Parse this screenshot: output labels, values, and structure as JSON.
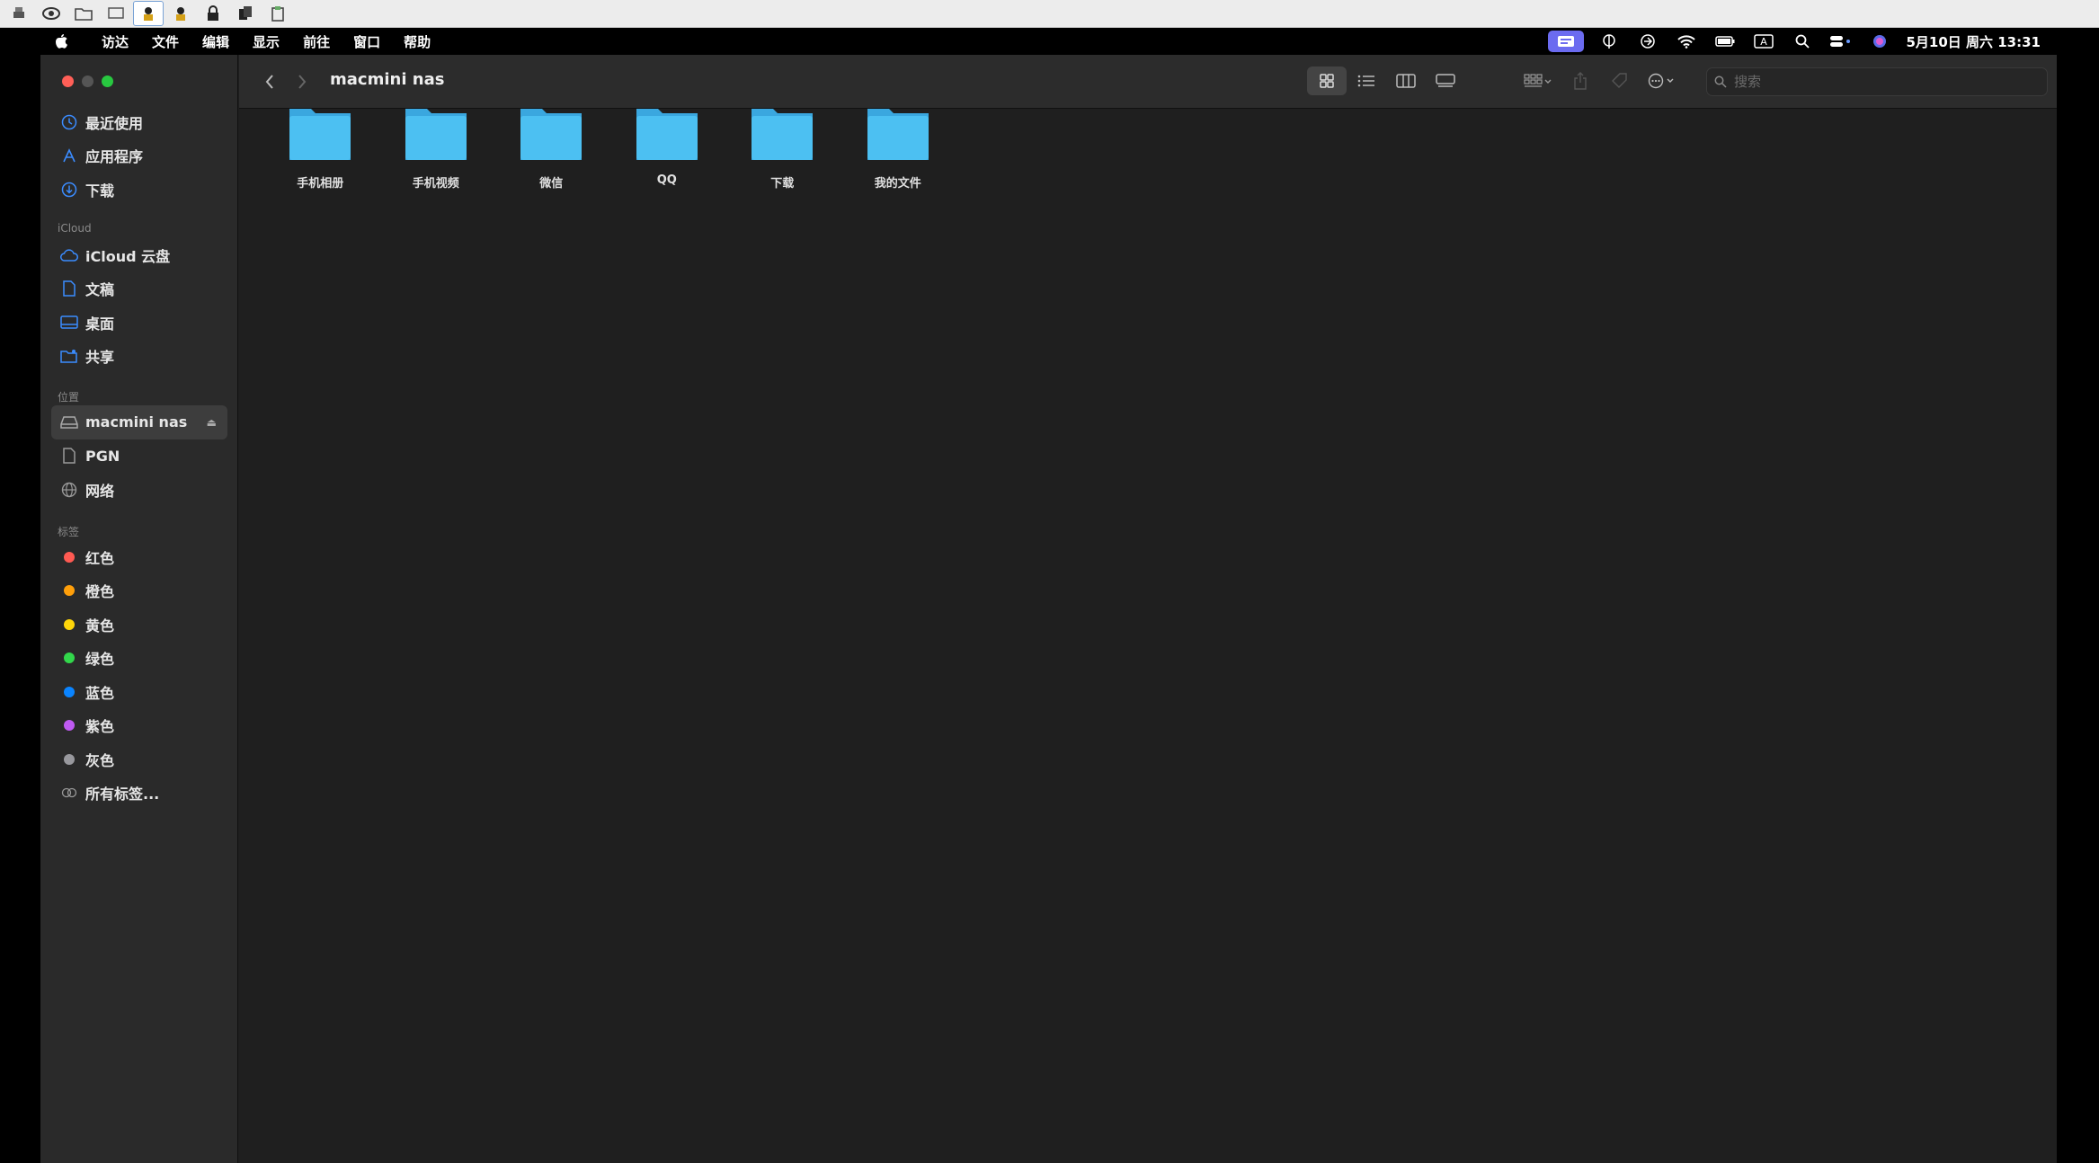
{
  "menubar": {
    "app_name": "访达",
    "items": [
      "文件",
      "编辑",
      "显示",
      "前往",
      "窗口",
      "帮助"
    ],
    "clock": "5月10日 周六 13:31"
  },
  "window": {
    "path_title": "macmini nas",
    "search_placeholder": "搜索"
  },
  "sidebar": {
    "favorites": [
      {
        "label": "最近使用",
        "icon": "clock-icon"
      },
      {
        "label": "应用程序",
        "icon": "apps-icon"
      },
      {
        "label": "下载",
        "icon": "download-icon"
      }
    ],
    "icloud_header": "iCloud",
    "icloud": [
      {
        "label": "iCloud 云盘",
        "icon": "cloud-icon"
      },
      {
        "label": "文稿",
        "icon": "document-icon"
      },
      {
        "label": "桌面",
        "icon": "desktop-icon"
      },
      {
        "label": "共享",
        "icon": "shared-folder-icon"
      }
    ],
    "locations_header": "位置",
    "locations": [
      {
        "label": "macmini nas",
        "icon": "drive-icon",
        "selected": true
      },
      {
        "label": "PGN",
        "icon": "document-icon"
      },
      {
        "label": "网络",
        "icon": "network-icon"
      }
    ],
    "tags_header": "标签",
    "tags": [
      {
        "label": "红色",
        "color": "#ff5a52"
      },
      {
        "label": "橙色",
        "color": "#ff9f0a"
      },
      {
        "label": "黄色",
        "color": "#ffd60a"
      },
      {
        "label": "绿色",
        "color": "#32d74b"
      },
      {
        "label": "蓝色",
        "color": "#0a84ff"
      },
      {
        "label": "紫色",
        "color": "#bf5af2"
      },
      {
        "label": "灰色",
        "color": "#98989d"
      }
    ],
    "all_tags": "所有标签..."
  },
  "folders": [
    "手机相册",
    "手机视频",
    "微信",
    "QQ",
    "下载",
    "我的文件"
  ],
  "colors": {
    "folder": "#3bb5ee",
    "accent": "#0a84ff"
  }
}
